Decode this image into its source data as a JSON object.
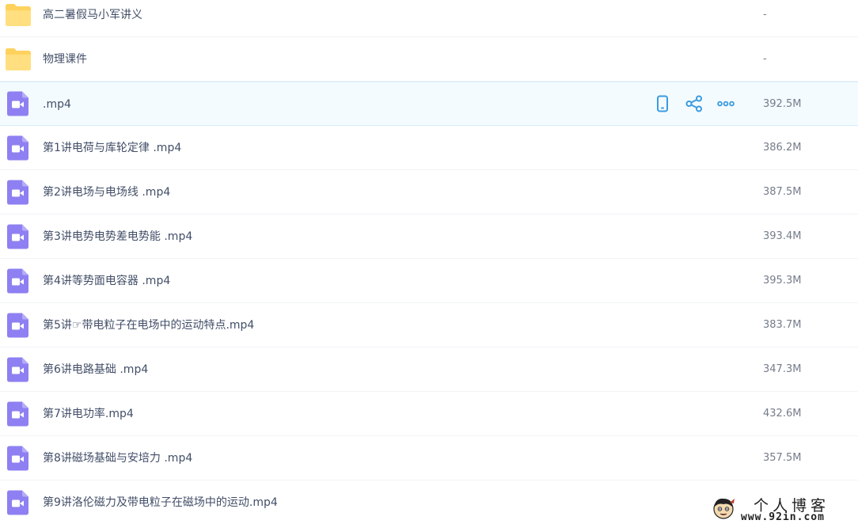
{
  "files": [
    {
      "name": "高二暑假马小军讲义",
      "size": "-",
      "type": "folder"
    },
    {
      "name": "物理课件",
      "size": "-",
      "type": "folder"
    },
    {
      "name": ".mp4",
      "size": "392.5M",
      "type": "video",
      "hover": true
    },
    {
      "name": "第1讲电荷与库轮定律 .mp4",
      "size": "386.2M",
      "type": "video"
    },
    {
      "name": "第2讲电场与电场线 .mp4",
      "size": "387.5M",
      "type": "video"
    },
    {
      "name": "第3讲电势电势差电势能 .mp4",
      "size": "393.4M",
      "type": "video"
    },
    {
      "name": "第4讲等势面电容器 .mp4",
      "size": "395.3M",
      "type": "video"
    },
    {
      "name": "第5讲☞带电粒子在电场中的运动特点.mp4",
      "size": "383.7M",
      "type": "video"
    },
    {
      "name": "第6讲电路基础 .mp4",
      "size": "347.3M",
      "type": "video"
    },
    {
      "name": "第7讲电功率.mp4",
      "size": "432.6M",
      "type": "video"
    },
    {
      "name": "第8讲磁场基础与安培力 .mp4",
      "size": "357.5M",
      "type": "video"
    },
    {
      "name": "第9讲洛伦磁力及带电粒子在磁场中的运动.mp4",
      "size": "",
      "type": "video"
    }
  ],
  "row_actions": [
    {
      "icon": "phone-icon",
      "name": "phone-button"
    },
    {
      "icon": "share-icon",
      "name": "share-button"
    },
    {
      "icon": "more-icon",
      "name": "more-button"
    }
  ],
  "colors": {
    "folder": "#ffd25e",
    "video": "#8e80f2",
    "accent": "#3b9bdf",
    "hover_bg": "#f4fbff"
  },
  "watermark": {
    "title": "个人博客",
    "url": "www.92in.com"
  }
}
